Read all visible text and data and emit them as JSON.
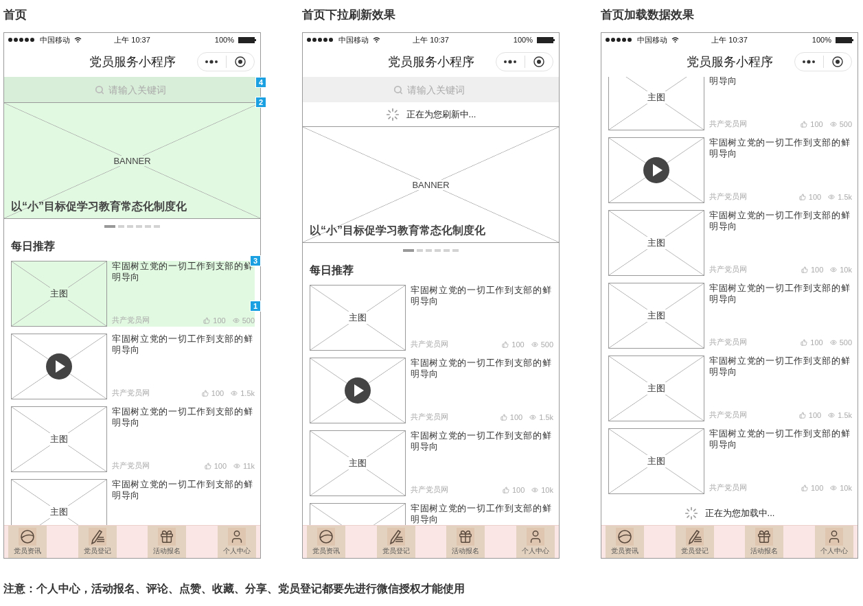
{
  "screens": [
    {
      "heading": "首页",
      "status": {
        "carrier": "中国移动",
        "time": "上午 10:37",
        "battery": "100%"
      },
      "nav_title": "党员服务小程序",
      "search": {
        "placeholder": "请输入关键词",
        "highlighted": true,
        "annotation": "4"
      },
      "banner": {
        "label": "BANNER",
        "caption": "以“小”目标促学习教育常态化制度化",
        "highlighted": true,
        "annotation": "2",
        "pages": [
          {
            "selected": true
          },
          {
            "selected": false
          },
          {
            "selected": false
          },
          {
            "selected": false
          },
          {
            "selected": false
          },
          {
            "selected": false
          }
        ]
      },
      "section_title": "每日推荐",
      "items": [
        {
          "kind": "image",
          "image_label": "主图",
          "title": "牢固树立党的一切工作到支部的鲜明导向",
          "source": "共产党员网",
          "likes": "100",
          "views": "500",
          "highlighted": true,
          "annotations": [
            "3",
            "1"
          ]
        },
        {
          "kind": "video",
          "title": "牢固树立党的一切工作到支部的鲜明导向",
          "source": "共产党员网",
          "likes": "100",
          "views": "1.5k",
          "highlighted": false
        },
        {
          "kind": "image",
          "image_label": "主图",
          "title": "牢固树立党的一切工作到支部的鲜明导向",
          "source": "共产党员网",
          "likes": "100",
          "views": "11k",
          "highlighted": false
        },
        {
          "kind": "image",
          "image_label": "主图",
          "title": "牢固树立党的一切工作到支部的鲜明导向",
          "highlighted": false
        }
      ],
      "tabs": [
        {
          "kind": "globe",
          "label": "党员资讯"
        },
        {
          "kind": "pen",
          "label": "党员登记"
        },
        {
          "kind": "gift",
          "label": "活动报名"
        },
        {
          "kind": "user",
          "label": "个人中心"
        }
      ]
    },
    {
      "heading": "首页下拉刷新效果",
      "status": {
        "carrier": "中国移动",
        "time": "上午 10:37",
        "battery": "100%"
      },
      "nav_title": "党员服务小程序",
      "search": {
        "placeholder": "请输入关键词",
        "highlighted": false
      },
      "refresh_text": "正在为您刷新中...",
      "banner": {
        "label": "BANNER",
        "caption": "以“小”目标促学习教育常态化制度化",
        "highlighted": false,
        "pages": [
          {
            "selected": true
          },
          {
            "selected": false
          },
          {
            "selected": false
          },
          {
            "selected": false
          },
          {
            "selected": false
          },
          {
            "selected": false
          }
        ]
      },
      "section_title": "每日推荐",
      "items": [
        {
          "kind": "image",
          "image_label": "主图",
          "title": "牢固树立党的一切工作到支部的鲜明导向",
          "source": "共产党员网",
          "likes": "100",
          "views": "500",
          "highlighted": false
        },
        {
          "kind": "video",
          "title": "牢固树立党的一切工作到支部的鲜明导向",
          "source": "共产党员网",
          "likes": "100",
          "views": "1.5k",
          "highlighted": false
        },
        {
          "kind": "image",
          "image_label": "主图",
          "title": "牢固树立党的一切工作到支部的鲜明导向",
          "source": "共产党员网",
          "likes": "100",
          "views": "10k",
          "highlighted": false
        },
        {
          "kind": "image",
          "title": "牢固树立党的一切工作到支部的鲜明导向",
          "highlighted": false
        }
      ],
      "tabs": [
        {
          "kind": "globe",
          "label": "党员资讯"
        },
        {
          "kind": "pen",
          "label": "党员登记"
        },
        {
          "kind": "gift",
          "label": "活动报名"
        },
        {
          "kind": "user",
          "label": "个人中心"
        }
      ]
    },
    {
      "heading": "首页加载数据效果",
      "status": {
        "carrier": "中国移动",
        "time": "上午 10:37",
        "battery": "100%"
      },
      "nav_title": "党员服务小程序",
      "scrolled": true,
      "items": [
        {
          "kind": "image",
          "image_label": "主图",
          "title": "明导向",
          "clipped_top": true,
          "source": "共产党员网",
          "likes": "100",
          "views": "500",
          "highlighted": false
        },
        {
          "kind": "video",
          "title": "牢固树立党的一切工作到支部的鲜明导向",
          "source": "共产党员网",
          "likes": "100",
          "views": "1.5k",
          "highlighted": false
        },
        {
          "kind": "image",
          "image_label": "主图",
          "title": "牢固树立党的一切工作到支部的鲜明导向",
          "source": "共产党员网",
          "likes": "100",
          "views": "10k",
          "highlighted": false
        },
        {
          "kind": "image",
          "image_label": "主图",
          "title": "牢固树立党的一切工作到支部的鲜明导向",
          "source": "共产党员网",
          "likes": "100",
          "views": "500",
          "highlighted": false
        },
        {
          "kind": "image",
          "image_label": "主图",
          "title": "牢固树立党的一切工作到支部的鲜明导向",
          "source": "共产党员网",
          "likes": "100",
          "views": "1.5k",
          "highlighted": false
        },
        {
          "kind": "image",
          "image_label": "主图",
          "title": "牢固树立党的一切工作到支部的鲜明导向",
          "source": "共产党员网",
          "likes": "100",
          "views": "10k",
          "highlighted": false
        }
      ],
      "loading_text": "正在为您加载中...",
      "tabs": [
        {
          "kind": "globe",
          "label": "党员资讯"
        },
        {
          "kind": "pen",
          "label": "党员登记"
        },
        {
          "kind": "gift",
          "label": "活动报名"
        },
        {
          "kind": "user",
          "label": "个人中心"
        }
      ]
    }
  ],
  "note": "注意：个人中心，活动报名、评论、点赞、收藏、分享、党员登记都要先进行微信授权才能使用"
}
